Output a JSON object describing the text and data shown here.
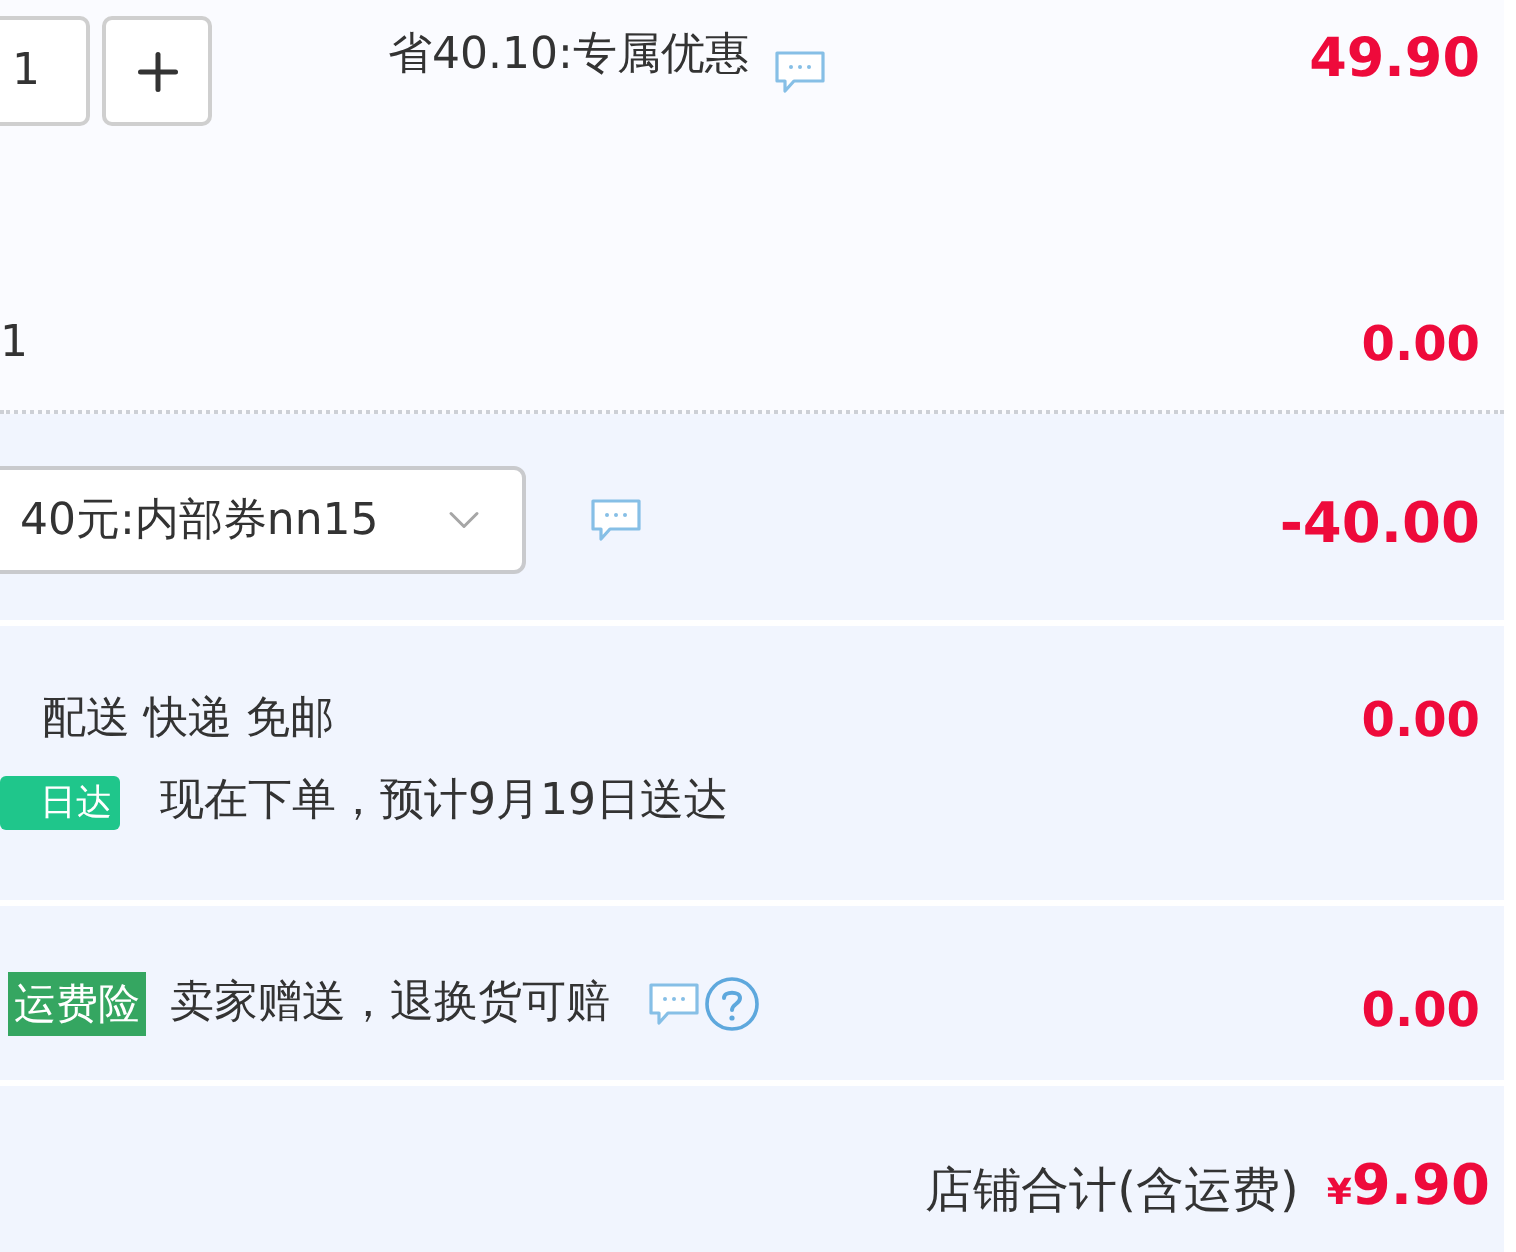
{
  "item": {
    "quantity": "1",
    "discount": "省40.10:专属优惠",
    "price": "49.90"
  },
  "item_extra": {
    "column_1": "1",
    "amount": "0.00"
  },
  "coupon": {
    "value": "40元:内部券nn15",
    "amount": "-40.00"
  },
  "delivery": {
    "method": "配送 快递 免邮",
    "badge": "日达",
    "eta": "现在下单，预计9月19日送达",
    "fee": "0.00"
  },
  "insurance": {
    "badge": "运费险",
    "text": "卖家赠送，退换货可赔",
    "fee": "0.00"
  },
  "total": {
    "label": "店铺合计(含运费)",
    "currency": "¥",
    "amount": "9.90"
  }
}
